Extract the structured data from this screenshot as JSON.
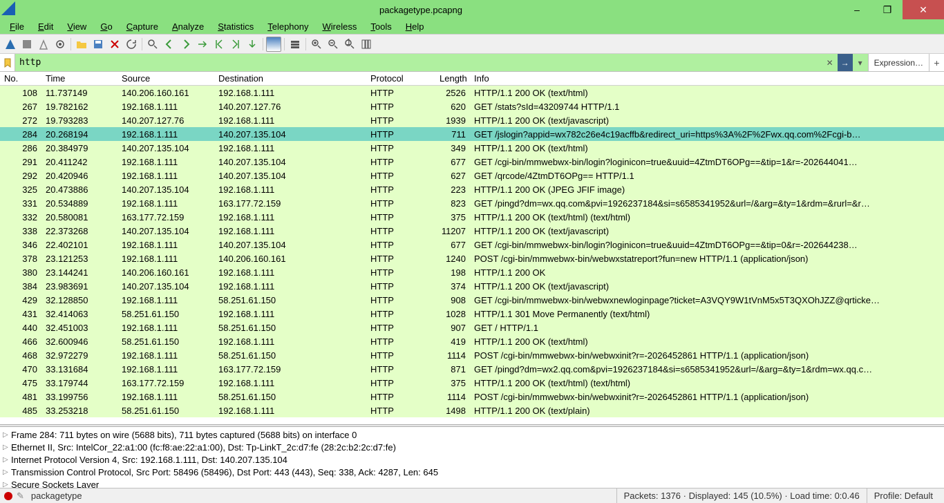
{
  "window": {
    "title": "packagetype.pcapng"
  },
  "menu": [
    "File",
    "Edit",
    "View",
    "Go",
    "Capture",
    "Analyze",
    "Statistics",
    "Telephony",
    "Wireless",
    "Tools",
    "Help"
  ],
  "filter": {
    "value": "http",
    "expression_label": "Expression…"
  },
  "columns": {
    "no": "No.",
    "time": "Time",
    "source": "Source",
    "destination": "Destination",
    "protocol": "Protocol",
    "length": "Length",
    "info": "Info"
  },
  "selected_no": 284,
  "packets": [
    {
      "no": 108,
      "time": "11.737149",
      "src": "140.206.160.161",
      "dst": "192.168.1.111",
      "proto": "HTTP",
      "len": 2526,
      "info": "HTTP/1.1 200 OK  (text/html)"
    },
    {
      "no": 267,
      "time": "19.782162",
      "src": "192.168.1.111",
      "dst": "140.207.127.76",
      "proto": "HTTP",
      "len": 620,
      "info": "GET /stats?sId=43209744 HTTP/1.1"
    },
    {
      "no": 272,
      "time": "19.793283",
      "src": "140.207.127.76",
      "dst": "192.168.1.111",
      "proto": "HTTP",
      "len": 1939,
      "info": "HTTP/1.1 200 OK  (text/javascript)"
    },
    {
      "no": 284,
      "time": "20.268194",
      "src": "192.168.1.111",
      "dst": "140.207.135.104",
      "proto": "HTTP",
      "len": 711,
      "info": "GET /jslogin?appid=wx782c26e4c19acffb&redirect_uri=https%3A%2F%2Fwx.qq.com%2Fcgi-b…"
    },
    {
      "no": 286,
      "time": "20.384979",
      "src": "140.207.135.104",
      "dst": "192.168.1.111",
      "proto": "HTTP",
      "len": 349,
      "info": "HTTP/1.1 200 OK  (text/html)"
    },
    {
      "no": 291,
      "time": "20.411242",
      "src": "192.168.1.111",
      "dst": "140.207.135.104",
      "proto": "HTTP",
      "len": 677,
      "info": "GET /cgi-bin/mmwebwx-bin/login?loginicon=true&uuid=4ZtmDT6OPg==&tip=1&r=-202644041…"
    },
    {
      "no": 292,
      "time": "20.420946",
      "src": "192.168.1.111",
      "dst": "140.207.135.104",
      "proto": "HTTP",
      "len": 627,
      "info": "GET /qrcode/4ZtmDT6OPg== HTTP/1.1"
    },
    {
      "no": 325,
      "time": "20.473886",
      "src": "140.207.135.104",
      "dst": "192.168.1.111",
      "proto": "HTTP",
      "len": 223,
      "info": "HTTP/1.1 200 OK  (JPEG JFIF image)"
    },
    {
      "no": 331,
      "time": "20.534889",
      "src": "192.168.1.111",
      "dst": "163.177.72.159",
      "proto": "HTTP",
      "len": 823,
      "info": "GET /pingd?dm=wx.qq.com&pvi=1926237184&si=s6585341952&url=/&arg=&ty=1&rdm=&rurl=&r…"
    },
    {
      "no": 332,
      "time": "20.580081",
      "src": "163.177.72.159",
      "dst": "192.168.1.111",
      "proto": "HTTP",
      "len": 375,
      "info": "HTTP/1.1 200 OK  (text/html) (text/html)"
    },
    {
      "no": 338,
      "time": "22.373268",
      "src": "140.207.135.104",
      "dst": "192.168.1.111",
      "proto": "HTTP",
      "len": 11207,
      "info": "HTTP/1.1 200 OK  (text/javascript)"
    },
    {
      "no": 346,
      "time": "22.402101",
      "src": "192.168.1.111",
      "dst": "140.207.135.104",
      "proto": "HTTP",
      "len": 677,
      "info": "GET /cgi-bin/mmwebwx-bin/login?loginicon=true&uuid=4ZtmDT6OPg==&tip=0&r=-202644238…"
    },
    {
      "no": 378,
      "time": "23.121253",
      "src": "192.168.1.111",
      "dst": "140.206.160.161",
      "proto": "HTTP",
      "len": 1240,
      "info": "POST /cgi-bin/mmwebwx-bin/webwxstatreport?fun=new HTTP/1.1  (application/json)"
    },
    {
      "no": 380,
      "time": "23.144241",
      "src": "140.206.160.161",
      "dst": "192.168.1.111",
      "proto": "HTTP",
      "len": 198,
      "info": "HTTP/1.1 200 OK"
    },
    {
      "no": 384,
      "time": "23.983691",
      "src": "140.207.135.104",
      "dst": "192.168.1.111",
      "proto": "HTTP",
      "len": 374,
      "info": "HTTP/1.1 200 OK  (text/javascript)"
    },
    {
      "no": 429,
      "time": "32.128850",
      "src": "192.168.1.111",
      "dst": "58.251.61.150",
      "proto": "HTTP",
      "len": 908,
      "info": "GET /cgi-bin/mmwebwx-bin/webwxnewloginpage?ticket=A3VQY9W1tVnM5x5T3QXOhJZZ@qrticke…"
    },
    {
      "no": 431,
      "time": "32.414063",
      "src": "58.251.61.150",
      "dst": "192.168.1.111",
      "proto": "HTTP",
      "len": 1028,
      "info": "HTTP/1.1 301 Move Permanently  (text/html)"
    },
    {
      "no": 440,
      "time": "32.451003",
      "src": "192.168.1.111",
      "dst": "58.251.61.150",
      "proto": "HTTP",
      "len": 907,
      "info": "GET / HTTP/1.1"
    },
    {
      "no": 466,
      "time": "32.600946",
      "src": "58.251.61.150",
      "dst": "192.168.1.111",
      "proto": "HTTP",
      "len": 419,
      "info": "HTTP/1.1 200 OK  (text/html)"
    },
    {
      "no": 468,
      "time": "32.972279",
      "src": "192.168.1.111",
      "dst": "58.251.61.150",
      "proto": "HTTP",
      "len": 1114,
      "info": "POST /cgi-bin/mmwebwx-bin/webwxinit?r=-2026452861 HTTP/1.1  (application/json)"
    },
    {
      "no": 470,
      "time": "33.131684",
      "src": "192.168.1.111",
      "dst": "163.177.72.159",
      "proto": "HTTP",
      "len": 871,
      "info": "GET /pingd?dm=wx2.qq.com&pvi=1926237184&si=s6585341952&url=/&arg=&ty=1&rdm=wx.qq.c…"
    },
    {
      "no": 475,
      "time": "33.179744",
      "src": "163.177.72.159",
      "dst": "192.168.1.111",
      "proto": "HTTP",
      "len": 375,
      "info": "HTTP/1.1 200 OK  (text/html) (text/html)"
    },
    {
      "no": 481,
      "time": "33.199756",
      "src": "192.168.1.111",
      "dst": "58.251.61.150",
      "proto": "HTTP",
      "len": 1114,
      "info": "POST /cgi-bin/mmwebwx-bin/webwxinit?r=-2026452861 HTTP/1.1  (application/json)"
    },
    {
      "no": 485,
      "time": "33.253218",
      "src": "58.251.61.150",
      "dst": "192.168.1.111",
      "proto": "HTTP",
      "len": 1498,
      "info": "HTTP/1.1 200 OK  (text/plain)"
    }
  ],
  "details": [
    "Frame 284: 711 bytes on wire (5688 bits), 711 bytes captured (5688 bits) on interface 0",
    "Ethernet II, Src: IntelCor_22:a1:00 (fc:f8:ae:22:a1:00), Dst: Tp-LinkT_2c:d7:fe (28:2c:b2:2c:d7:fe)",
    "Internet Protocol Version 4, Src: 192.168.1.111, Dst: 140.207.135.104",
    "Transmission Control Protocol, Src Port: 58496 (58496), Dst Port: 443 (443), Seq: 338, Ack: 4287, Len: 645",
    "Secure Sockets Layer"
  ],
  "status": {
    "file": "packagetype",
    "packets": "Packets: 1376 · Displayed: 145 (10.5%) · Load time: 0:0.46",
    "profile": "Profile: Default"
  }
}
